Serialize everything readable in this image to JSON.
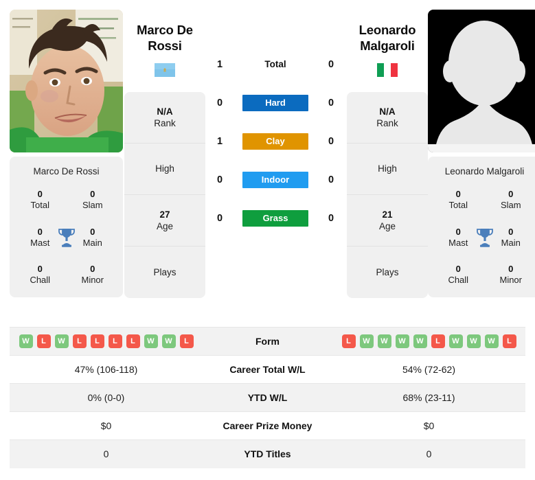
{
  "players": {
    "left": {
      "name": "Marco De Rossi",
      "name_line1": "Marco De",
      "name_line2": "Rossi",
      "flag": "san-marino-flag",
      "photo": "player-photo",
      "rank": "N/A",
      "rank_label": "Rank",
      "high_label": "High",
      "high_value": "",
      "age": "27",
      "age_label": "Age",
      "plays_label": "Plays",
      "plays_value": "",
      "titles": {
        "total": "0",
        "total_label": "Total",
        "slam": "0",
        "slam_label": "Slam",
        "mast": "0",
        "mast_label": "Mast",
        "main": "0",
        "main_label": "Main",
        "chall": "0",
        "chall_label": "Chall",
        "minor": "0",
        "minor_label": "Minor"
      },
      "form": [
        "W",
        "L",
        "W",
        "L",
        "L",
        "L",
        "L",
        "W",
        "W",
        "L"
      ],
      "career_total_wl": "47% (106-118)",
      "ytd_wl": "0% (0-0)",
      "career_prize_money": "$0",
      "ytd_titles": "0"
    },
    "right": {
      "name": "Leonardo Malgaroli",
      "name_line1": "Leonardo",
      "name_line2": "Malgaroli",
      "flag": "italy-flag",
      "photo": "avatar-placeholder",
      "rank": "N/A",
      "rank_label": "Rank",
      "high_label": "High",
      "high_value": "",
      "age": "21",
      "age_label": "Age",
      "plays_label": "Plays",
      "plays_value": "",
      "titles": {
        "total": "0",
        "total_label": "Total",
        "slam": "0",
        "slam_label": "Slam",
        "mast": "0",
        "mast_label": "Mast",
        "main": "0",
        "main_label": "Main",
        "chall": "0",
        "chall_label": "Chall",
        "minor": "0",
        "minor_label": "Minor"
      },
      "form": [
        "L",
        "W",
        "W",
        "W",
        "W",
        "L",
        "W",
        "W",
        "W",
        "L"
      ],
      "career_total_wl": "54% (72-62)",
      "ytd_wl": "68% (23-11)",
      "career_prize_money": "$0",
      "ytd_titles": "0"
    }
  },
  "head_to_head": [
    {
      "label": "Total",
      "left": "1",
      "right": "0",
      "color": "",
      "plain": true
    },
    {
      "label": "Hard",
      "left": "0",
      "right": "0",
      "color": "#0b6bbf",
      "plain": false
    },
    {
      "label": "Clay",
      "left": "1",
      "right": "0",
      "color": "#e09400",
      "plain": false
    },
    {
      "label": "Indoor",
      "left": "0",
      "right": "0",
      "color": "#209cf0",
      "plain": false
    },
    {
      "label": "Grass",
      "left": "0",
      "right": "0",
      "color": "#0f9e3e",
      "plain": false
    }
  ],
  "table_rows": [
    {
      "label": "Form",
      "type": "form"
    },
    {
      "label": "Career Total W/L",
      "type": "text",
      "key": "career_total_wl"
    },
    {
      "label": "YTD W/L",
      "type": "text",
      "key": "ytd_wl"
    },
    {
      "label": "Career Prize Money",
      "type": "text",
      "key": "career_prize_money"
    },
    {
      "label": "YTD Titles",
      "type": "text",
      "key": "ytd_titles"
    }
  ],
  "colors": {
    "win_badge": "#7dc87d",
    "loss_badge": "#f4584a",
    "trophy": "#4a7ebb",
    "card_bg": "#f0f0f0"
  }
}
